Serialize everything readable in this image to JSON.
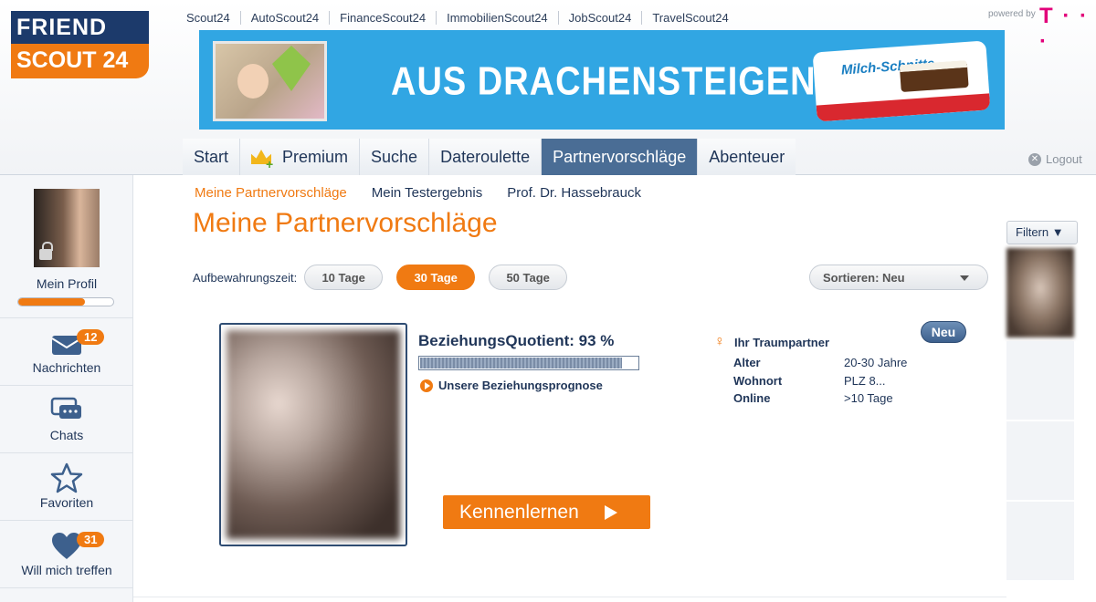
{
  "header": {
    "logo": {
      "line1": "FRIEND",
      "line2": "SCOUT 24"
    },
    "toplinks": [
      "Scout24",
      "AutoScout24",
      "FinanceScout24",
      "ImmobilienScout24",
      "JobScout24",
      "TravelScout24"
    ],
    "powered_by": "powered by",
    "telekom_logo": "T · · ·",
    "banner": {
      "headline": "AUS DRACHENSTEIGEN WIRD ...",
      "product": "Milch-Schnitte"
    },
    "nav": [
      {
        "label": "Start",
        "active": false
      },
      {
        "label": "Premium",
        "active": false,
        "icon": "crown-icon"
      },
      {
        "label": "Suche",
        "active": false
      },
      {
        "label": "Dateroulette",
        "active": false
      },
      {
        "label": "Partnervorschläge",
        "active": true
      },
      {
        "label": "Abenteuer",
        "active": false
      }
    ],
    "logout": "Logout"
  },
  "sidebar": {
    "profile": {
      "label": "Mein Profil",
      "progress": 0.7
    },
    "items": [
      {
        "label": "Nachrichten",
        "badge": "12",
        "icon": "envelope-icon"
      },
      {
        "label": "Chats",
        "icon": "chat-bubbles-icon"
      },
      {
        "label": "Favoriten",
        "icon": "star-icon"
      },
      {
        "label": "Will mich treffen",
        "badge": "31",
        "icon": "heart-icon"
      }
    ]
  },
  "main": {
    "subnav": [
      "Meine Partnervorschläge",
      "Mein Testergebnis",
      "Prof. Dr. Hassebrauck"
    ],
    "title": "Meine Partnervorschläge",
    "retention": {
      "label": "Aufbewahrungszeit:",
      "options": [
        "10 Tage",
        "30 Tage",
        "50 Tage"
      ],
      "selected": "30 Tage"
    },
    "sort": "Sortieren: Neu",
    "card": {
      "bq_title": "BeziehungsQuotient: 93 %",
      "bq_value": 93,
      "prognose": "Unsere Beziehungsprognose",
      "dream_label": "Ihr Traumpartner",
      "badge": "Neu",
      "details": [
        {
          "key": "Alter",
          "value": "20-30 Jahre"
        },
        {
          "key": "Wohnort",
          "value": "PLZ 8..."
        },
        {
          "key": "Online",
          "value": ">10 Tage"
        }
      ],
      "cta": "Kennenlernen"
    }
  },
  "right": {
    "filter": "Filtern ▼"
  },
  "colors": {
    "brand_orange": "#f07a12",
    "brand_navy": "#1c3a6b",
    "nav_active": "#4a6d95"
  }
}
